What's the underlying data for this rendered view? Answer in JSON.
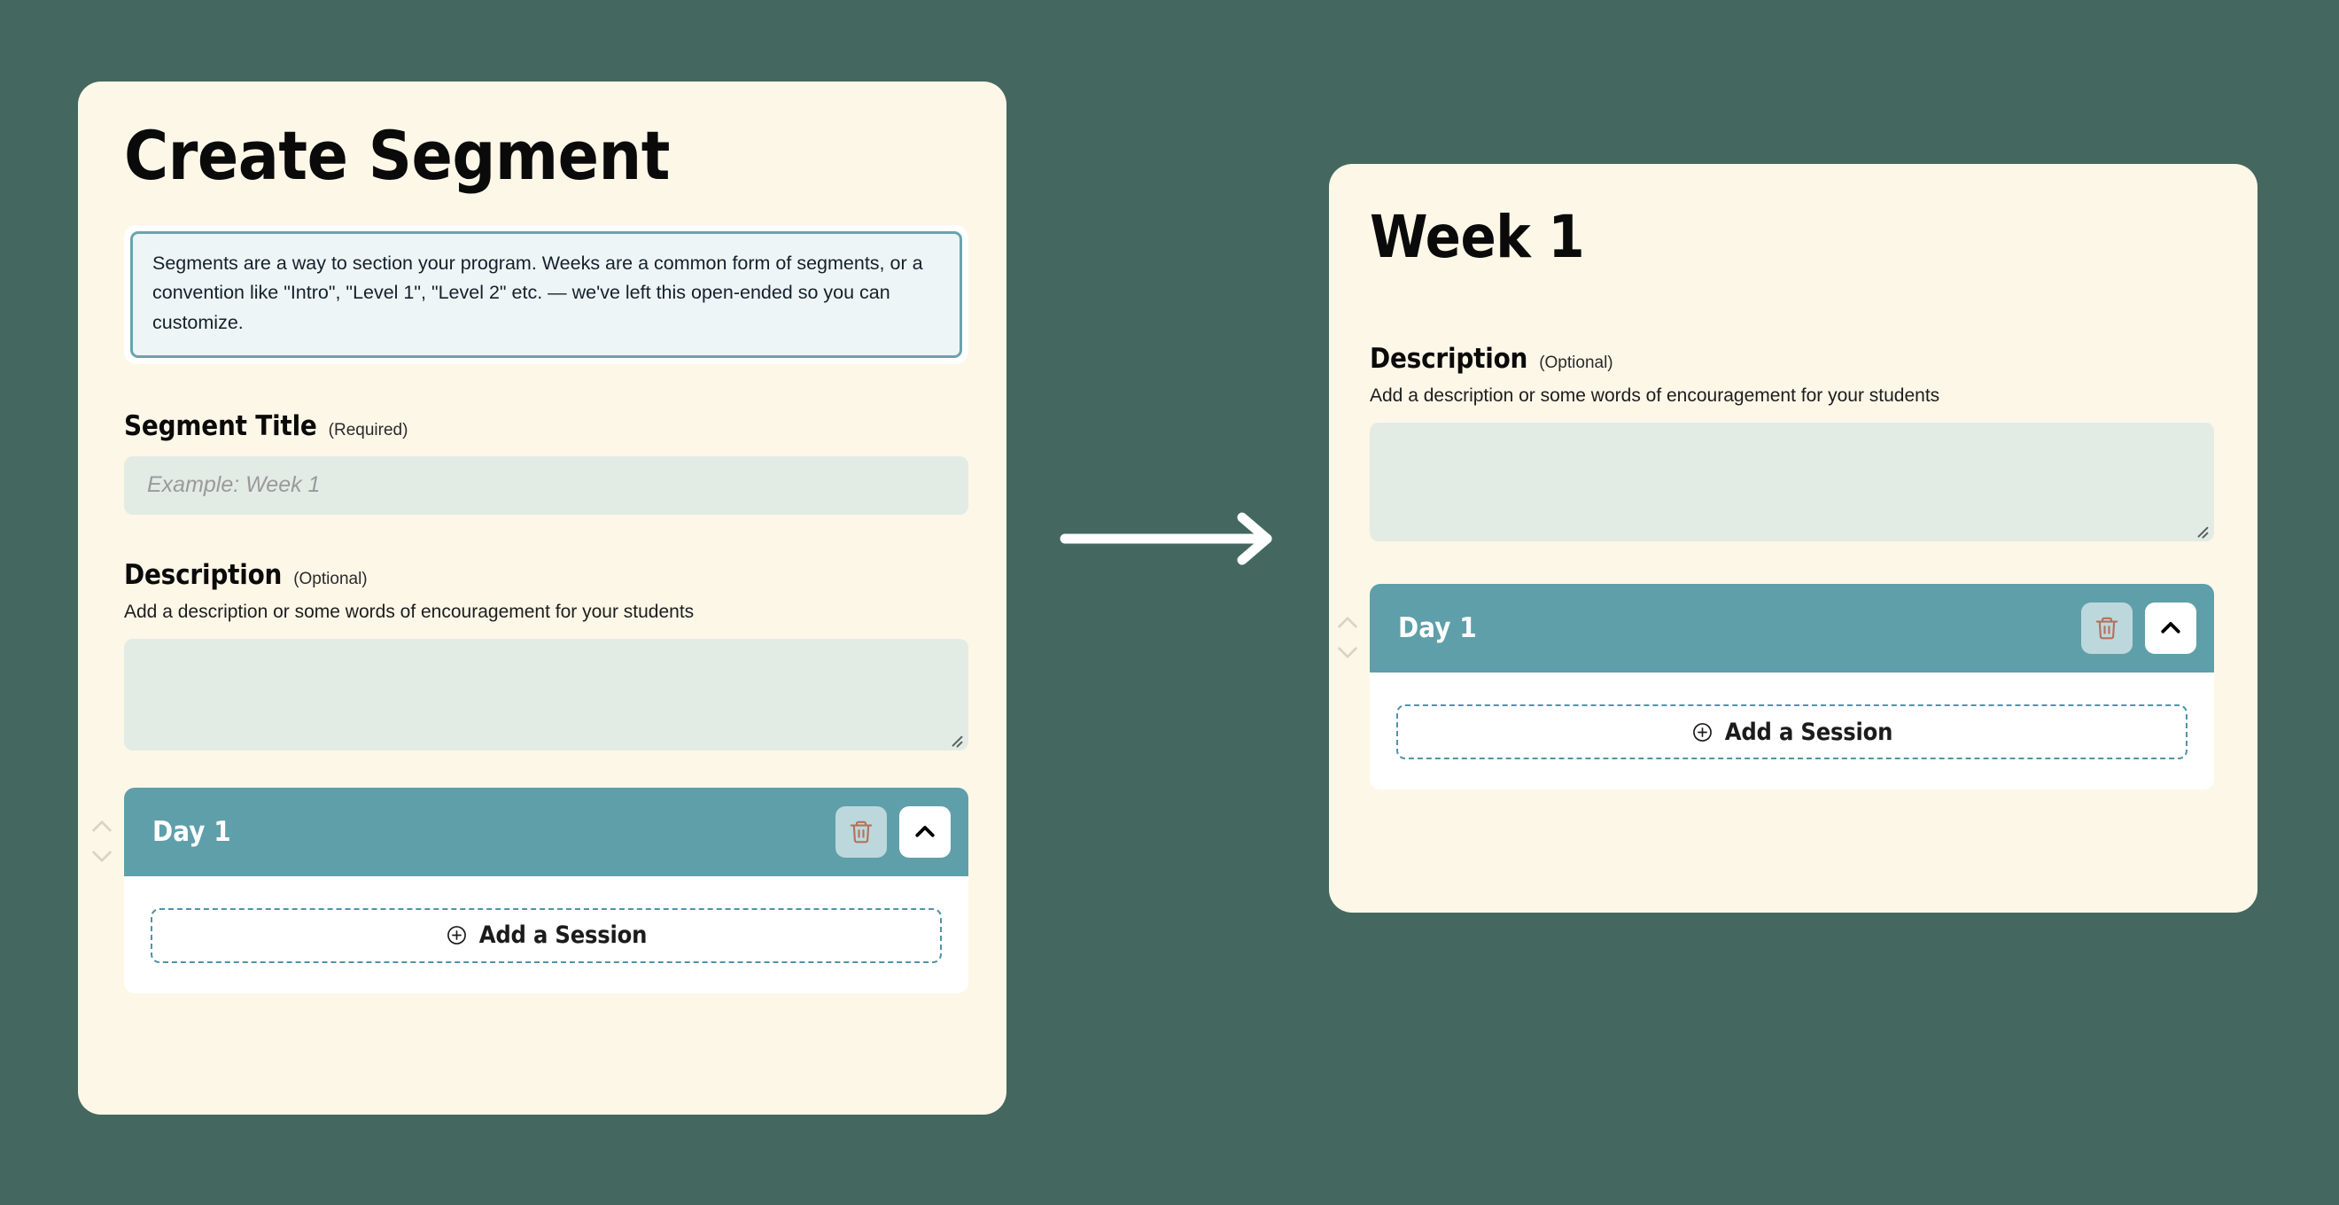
{
  "theme": {
    "background": "#44685f",
    "panel_bg": "#fdf7e8",
    "accent_teal": "#5f9fa9",
    "callout_border": "#6ba3ad",
    "callout_bg": "#eef5f7",
    "input_bg": "#e3ebe5",
    "delete_btn_bg": "#bcd8dc",
    "delete_icon": "#b5705c",
    "dashed_border": "#4f93a8",
    "arrow_color": "#ffffff"
  },
  "create_panel": {
    "title": "Create Segment",
    "callout": "Segments are a way to section your program. Weeks are a common form of segments, or a convention like \"Intro\", \"Level 1\", \"Level 2\" etc. — we've left this open-ended so you can customize.",
    "segment_title_field": {
      "label": "Segment Title",
      "note": "(Required)",
      "placeholder": "Example: Week 1",
      "value": ""
    },
    "description_field": {
      "label": "Description",
      "note": "(Optional)",
      "hint": "Add a description or some words of encouragement for your students",
      "value": ""
    },
    "day": {
      "title": "Day 1",
      "delete_label": "trash-icon",
      "collapse_label": "chevron-up-icon",
      "add_session_label": "Add a Session",
      "add_session_icon": "plus-circle-icon",
      "move_up_label": "chevron-up-icon",
      "move_down_label": "chevron-down-icon"
    }
  },
  "result_panel": {
    "title": "Week 1",
    "description_field": {
      "label": "Description",
      "note": "(Optional)",
      "hint": "Add a description or some words of encouragement for your students",
      "value": ""
    },
    "day": {
      "title": "Day 1",
      "delete_label": "trash-icon",
      "collapse_label": "chevron-up-icon",
      "add_session_label": "Add a Session",
      "add_session_icon": "plus-circle-icon",
      "move_up_label": "chevron-up-icon",
      "move_down_label": "chevron-down-icon"
    }
  },
  "connector": {
    "icon": "arrow-right-icon"
  }
}
